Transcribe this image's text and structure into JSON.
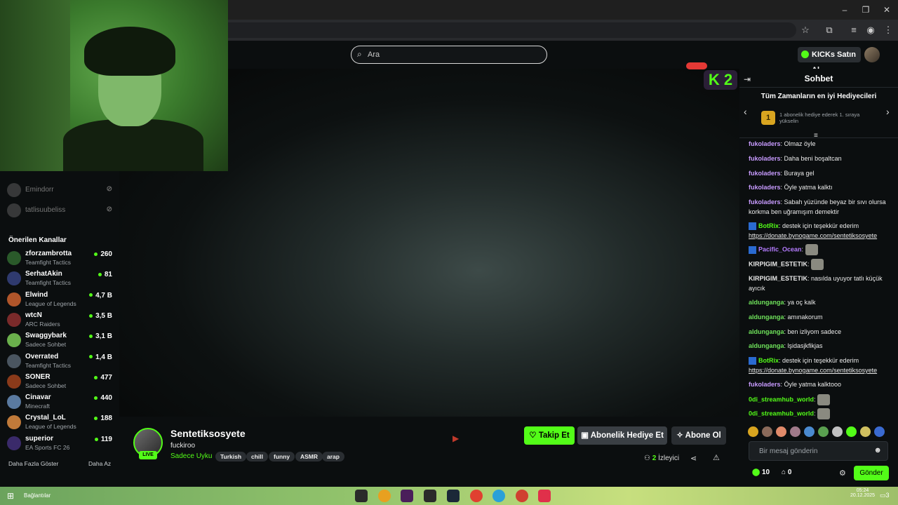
{
  "browser": {
    "bookmarks_label": "Bağlantılar"
  },
  "search": {
    "placeholder": "Ara"
  },
  "header": {
    "kicks_label": "KICKs Satın Al"
  },
  "overlay": {
    "k2": "K 2"
  },
  "sidebar": {
    "followed": [
      {
        "name": "Emindorr"
      },
      {
        "name": "tatlisuubeliss"
      }
    ],
    "recommended_title": "Önerilen Kanallar",
    "channels": [
      {
        "name": "zforzambrotta",
        "category": "Teamfight Tactics",
        "viewers": "260",
        "color": "#2a5a2a"
      },
      {
        "name": "SerhatAkin",
        "category": "Teamfight Tactics",
        "viewers": "81",
        "color": "#2f3a6e"
      },
      {
        "name": "Elwind",
        "category": "League of Legends",
        "viewers": "4,7 B",
        "color": "#b0552a"
      },
      {
        "name": "wtcN",
        "category": "ARC Raiders",
        "viewers": "3,5 B",
        "color": "#7a2a2a"
      },
      {
        "name": "Swaggybark",
        "category": "Sadece Sohbet",
        "viewers": "3,1 B",
        "color": "#6ab04c"
      },
      {
        "name": "Overrated",
        "category": "Teamfight Tactics",
        "viewers": "1,4 B",
        "color": "#4a5560"
      },
      {
        "name": "SONER",
        "category": "Sadece Sohbet",
        "viewers": "477",
        "color": "#8a3a1a"
      },
      {
        "name": "Cinavar",
        "category": "Minecraft",
        "viewers": "440",
        "color": "#5a7aa0"
      },
      {
        "name": "Crystal_LoL",
        "category": "League of Legends",
        "viewers": "188",
        "color": "#c07a3a"
      },
      {
        "name": "superior",
        "category": "EA Sports FC 26",
        "viewers": "119",
        "color": "#3a2a6a"
      }
    ],
    "show_more": "Daha Fazla Göster",
    "show_less": "Daha Az"
  },
  "stream": {
    "streamer": "Sentetiksosyete",
    "title": "fuckiroo",
    "category": "Sadece Uyku",
    "live_label": "LIVE",
    "tags": [
      "Turkish",
      "chill",
      "funny",
      "ASMR",
      "arap"
    ],
    "follow_label": "Takip Et",
    "gift_sub_label": "Abonelik Hediye Et",
    "subscribe_label": "Abone Ol",
    "viewer_count": "2",
    "viewer_label": "İzleyici"
  },
  "chat": {
    "title": "Sohbet",
    "gifters_title": "Tüm Zamanların en iyi Hediyecileri",
    "gifter_rank": "1",
    "gifter_hint": "1 abonelik hediye ederek 1. sıraya yükselin",
    "messages": [
      {
        "user": "fukoladers",
        "color": "#c89bff",
        "text": "Olmaz öyle"
      },
      {
        "user": "fukoladers",
        "color": "#c89bff",
        "text": "Daha beni boşaltcan"
      },
      {
        "user": "fukoladers",
        "color": "#c89bff",
        "text": "Buraya gel"
      },
      {
        "user": "fukoladers",
        "color": "#c89bff",
        "text": "Öyle yatma kalktı"
      },
      {
        "user": "fukoladers",
        "color": "#c89bff",
        "text": "Sabah yüzünde beyaz bir sıvı olursa korkma ben uğramışım demektir"
      },
      {
        "user": "BotRix",
        "color": "#53fc18",
        "text": "destek için teşekkür ederim",
        "link": "https://donate.bynogame.com/sentetiksosyete"
      },
      {
        "user": "Pacific_Ocean",
        "color": "#b57cff",
        "text": ""
      },
      {
        "user": "KIRPIGIM_ESTETIK",
        "color": "#e8e8e8",
        "text": ""
      },
      {
        "user": "KIRPIGIM_ESTETIK",
        "color": "#e8e8e8",
        "text": "nasılda uyuyor tatlı küçük ayıcık"
      },
      {
        "user": "aldunganga",
        "color": "#6ee05a",
        "text": "ya oç kalk"
      },
      {
        "user": "aldunganga",
        "color": "#6ee05a",
        "text": "amınakorum"
      },
      {
        "user": "aldunganga",
        "color": "#6ee05a",
        "text": "ben izliyom sadece"
      },
      {
        "user": "aldunganga",
        "color": "#6ee05a",
        "text": "lşidasjkfikjas"
      },
      {
        "user": "BotRix",
        "color": "#53fc18",
        "text": "destek için teşekkür ederim",
        "link": "https://donate.bynogame.com/sentetiksosyete"
      },
      {
        "user": "fukoladers",
        "color": "#c89bff",
        "text": "Öyle yatma kalktooo"
      },
      {
        "user": "0di_streamhub_world",
        "color": "#53fc18",
        "text": ""
      },
      {
        "user": "0di_streamhub_world",
        "color": "#53fc18",
        "text": ""
      }
    ],
    "input_placeholder": "Bir mesaj gönderin",
    "kicks_count": "10",
    "points_count": "0",
    "send_label": "Gönder"
  },
  "taskbar": {
    "time": "05:24",
    "date": "20.12.2025",
    "notifications": "3"
  }
}
